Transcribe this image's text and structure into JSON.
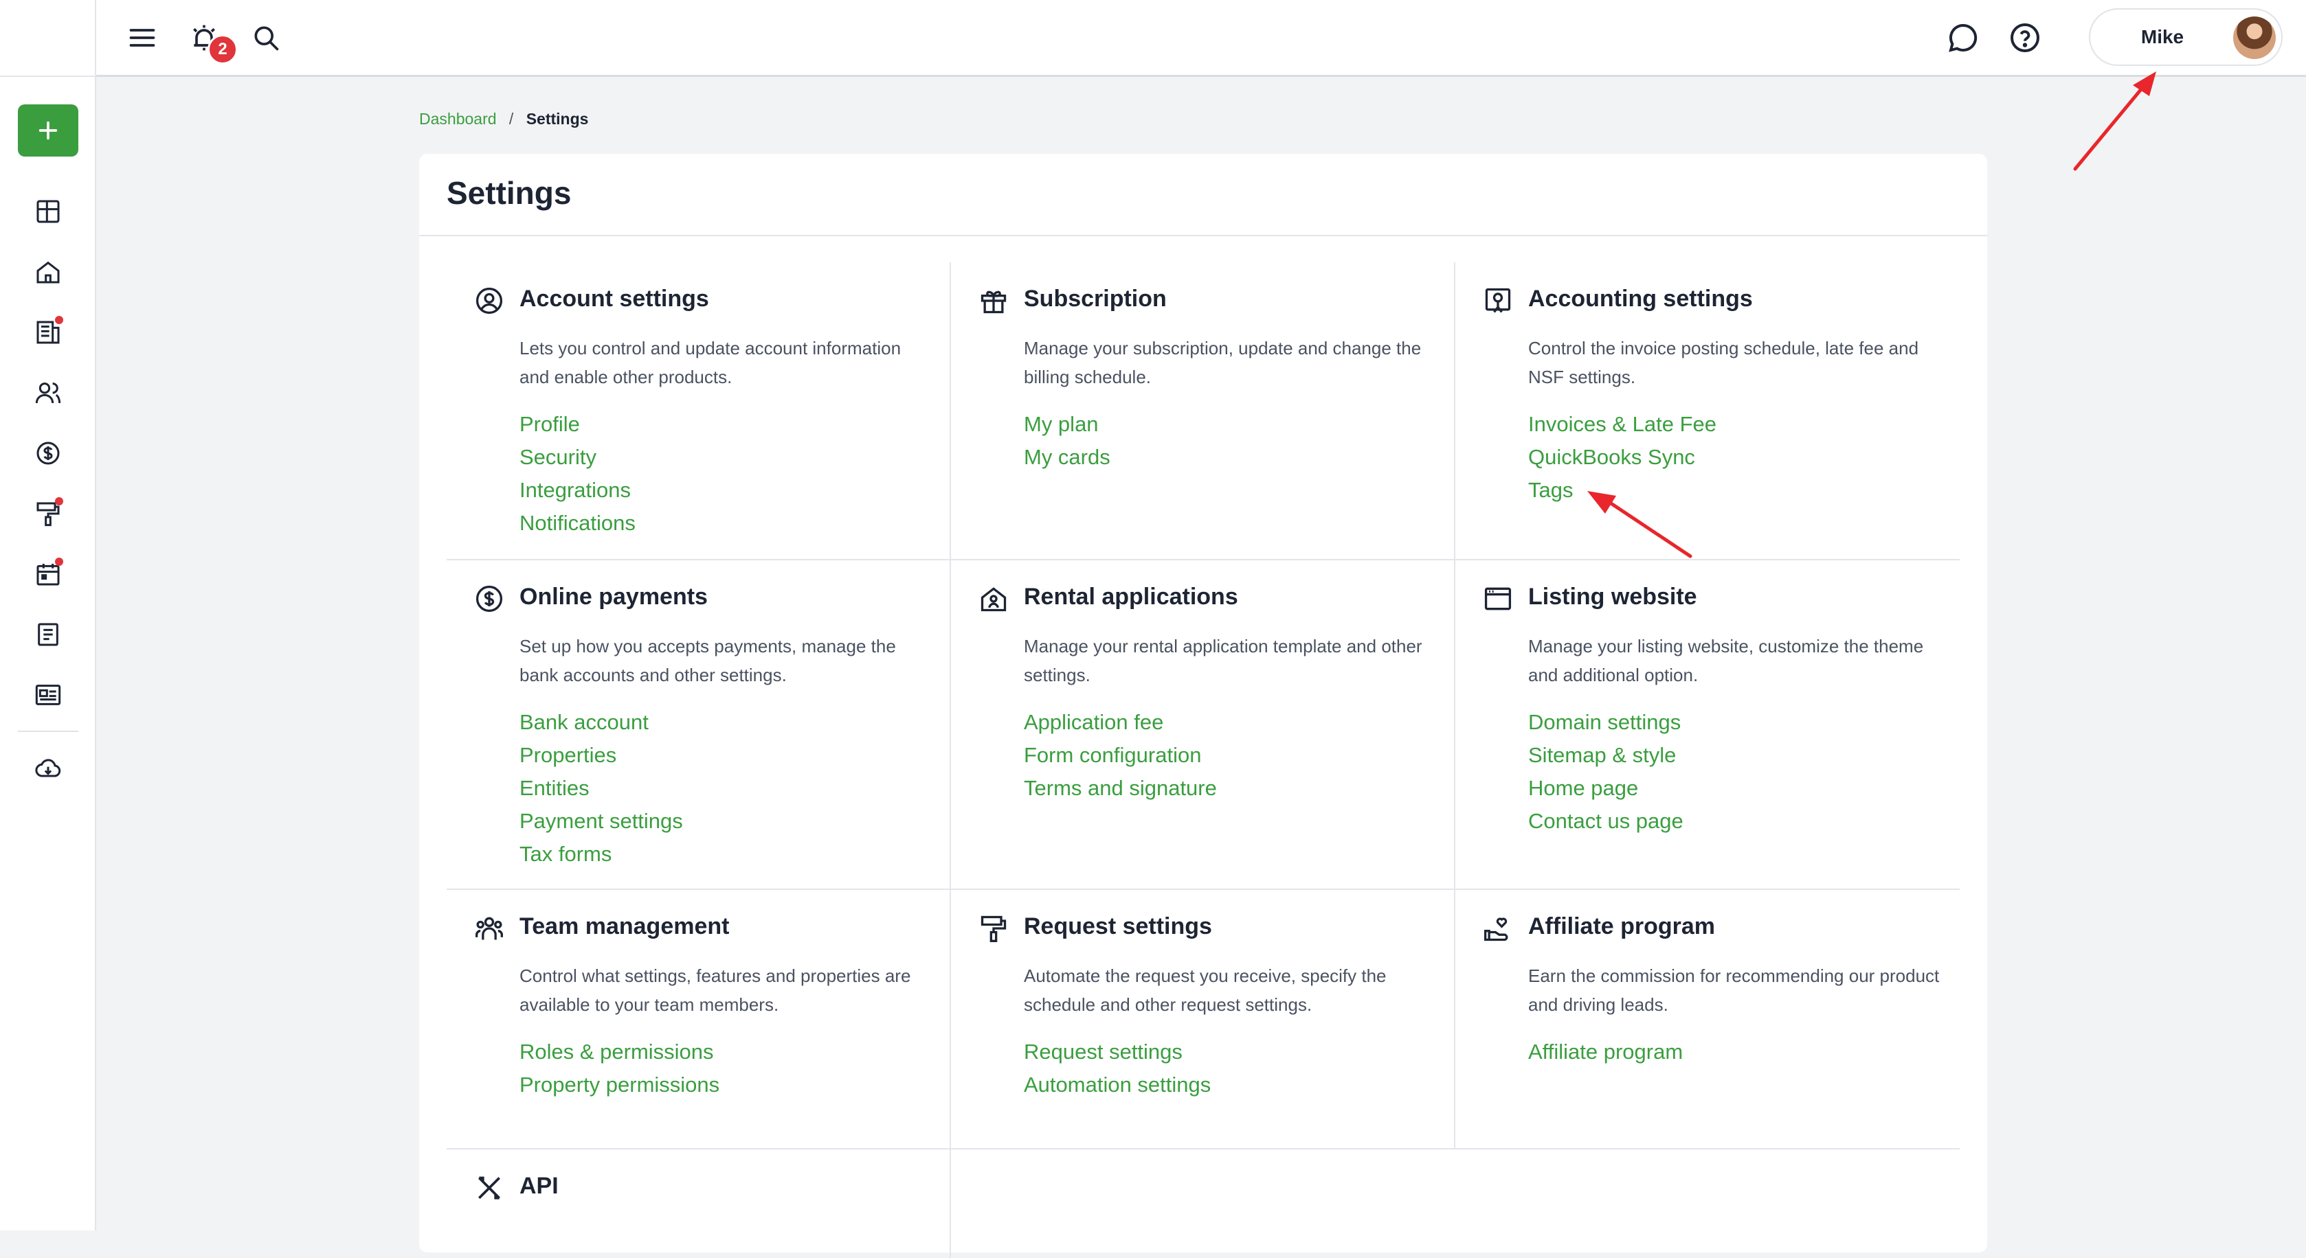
{
  "topbar": {
    "notification_count": "2",
    "user_name": "Mike"
  },
  "breadcrumb": {
    "home": "Dashboard",
    "separator": "/",
    "current": "Settings"
  },
  "page": {
    "title": "Settings"
  },
  "sections": [
    {
      "title": "Account settings",
      "icon": "user-circle-icon",
      "description": "Lets you control and update account information and enable other products.",
      "links": [
        "Profile",
        "Security",
        "Integrations",
        "Notifications"
      ]
    },
    {
      "title": "Subscription",
      "icon": "gift-icon",
      "description": "Manage your subscription, update and change the billing schedule.",
      "links": [
        "My plan",
        "My cards"
      ]
    },
    {
      "title": "Accounting settings",
      "icon": "accounting-icon",
      "description": "Control the invoice posting schedule, late fee and NSF settings.",
      "links": [
        "Invoices & Late Fee",
        "QuickBooks Sync",
        "Tags"
      ]
    },
    {
      "title": "Online payments",
      "icon": "dollar-circle-icon",
      "description": "Set up how you accepts payments, manage the bank accounts and other settings.",
      "links": [
        "Bank account",
        "Properties",
        "Entities",
        "Payment settings",
        "Tax forms"
      ]
    },
    {
      "title": "Rental applications",
      "icon": "house-person-icon",
      "description": "Manage your rental application template and other settings.",
      "links": [
        "Application fee",
        "Form configuration",
        "Terms and signature"
      ]
    },
    {
      "title": "Listing website",
      "icon": "browser-window-icon",
      "description": "Manage your listing website, customize the theme and additional option.",
      "links": [
        "Domain settings",
        "Sitemap & style",
        "Home page",
        "Contact us page"
      ]
    },
    {
      "title": "Team management",
      "icon": "team-icon",
      "description": "Control what settings, features and properties are available to your team members.",
      "links": [
        "Roles & permissions",
        "Property permissions"
      ]
    },
    {
      "title": "Request settings",
      "icon": "paint-roller-icon",
      "description": "Automate the request you receive, specify the schedule and other request settings.",
      "links": [
        "Request settings",
        "Automation settings"
      ]
    },
    {
      "title": "Affiliate program",
      "icon": "hand-heart-icon",
      "description": "Earn the commission for recommending our product and driving leads.",
      "links": [
        "Affiliate program"
      ]
    },
    {
      "title": "API",
      "icon": "tools-icon",
      "description": "",
      "links": []
    }
  ],
  "colors": {
    "accent_green": "#3a9e3f",
    "badge_red": "#e0353b",
    "annotation_red": "#e8262b"
  }
}
